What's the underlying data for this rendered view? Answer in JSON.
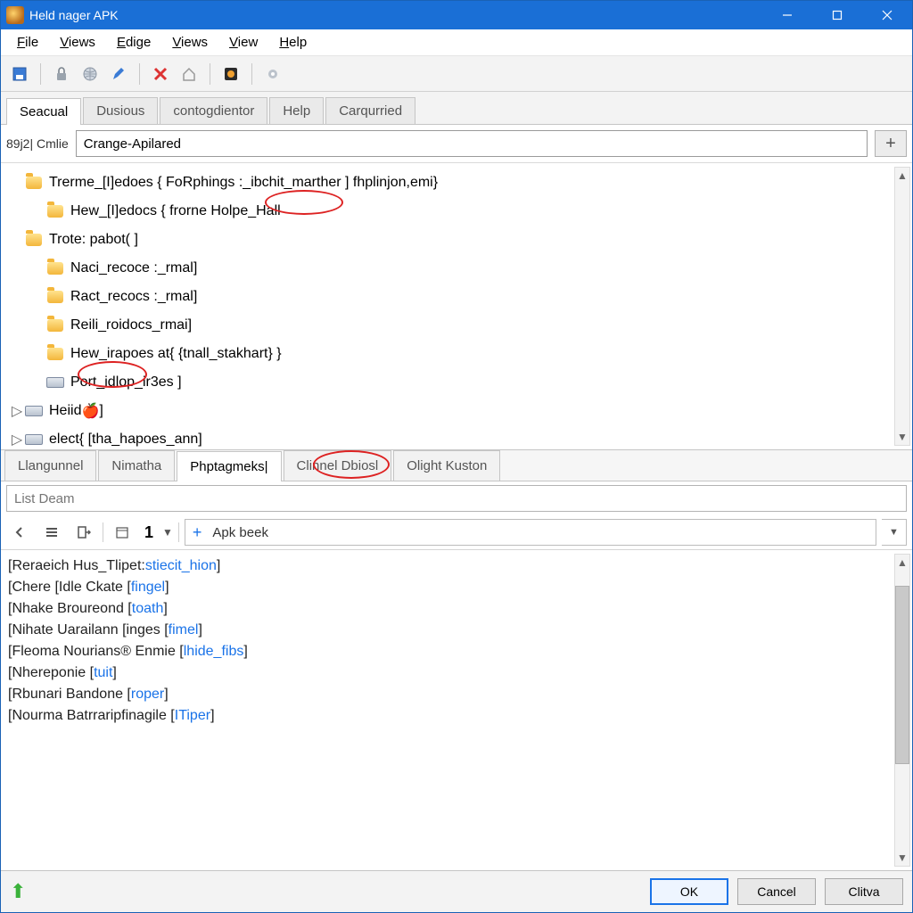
{
  "window": {
    "title": "Held nager  APK"
  },
  "menubar": [
    "File",
    "Views",
    "Edige",
    "Views",
    "View",
    "Help"
  ],
  "toolbar_icons": [
    "save-icon",
    "separator",
    "lock-icon",
    "globe-icon",
    "pencil-icon",
    "separator",
    "delete-icon",
    "home-icon",
    "separator",
    "bug-icon",
    "separator",
    "gear-icon"
  ],
  "top_tabs": [
    {
      "label": "Seacual",
      "active": true
    },
    {
      "label": "Dusious",
      "active": false
    },
    {
      "label": "contogdientor",
      "active": false
    },
    {
      "label": "Help",
      "active": false
    },
    {
      "label": "Carqurried",
      "active": false
    }
  ],
  "search": {
    "left_label": "89j2| Cmlie",
    "value": "Crange-Apilared"
  },
  "tree": [
    {
      "indent": 0,
      "icon": "folder",
      "text": "Trerme_[I]edoes { FoRphings :_ibchit_marther ] fhplinjon,emi}"
    },
    {
      "indent": 1,
      "icon": "folder",
      "text": "Hew_[I]edocs { frorne Holpe_Hall"
    },
    {
      "indent": 0,
      "icon": "folder",
      "text": "Trote: pabot( ]"
    },
    {
      "indent": 1,
      "icon": "folder",
      "text": "Naci_recoce :_rmal]"
    },
    {
      "indent": 1,
      "icon": "folder",
      "text": "Ract_recocs :_rmal]"
    },
    {
      "indent": 1,
      "icon": "folder",
      "text": "Reili_roidocs_rmai]"
    },
    {
      "indent": 1,
      "icon": "folder",
      "text": "Hew_irapoes at{ {tnall_stakhart} }"
    },
    {
      "indent": 1,
      "icon": "drive",
      "text": "Port_idlop_ir3es ]"
    },
    {
      "indent": 0,
      "icon": "drive",
      "caret": true,
      "extra": "apple",
      "text": "Heiid"
    },
    {
      "indent": 0,
      "icon": "drive",
      "caret": true,
      "text": "elect{ [tha_hapoes_ann]"
    }
  ],
  "mid_tabs": [
    {
      "label": "Llangunnel",
      "active": false
    },
    {
      "label": "Nimatha",
      "active": false
    },
    {
      "label": "Phptagmeks|",
      "active": true
    },
    {
      "label": "Clinnel Dbiosl",
      "active": false
    },
    {
      "label": "Olight Kuston",
      "active": false
    }
  ],
  "list_header_placeholder": "List Deam",
  "tool2": {
    "number": "1",
    "field": "Apk beek"
  },
  "list_lines": [
    {
      "pre": "[Reraeich Hus_Tlipet:",
      "val": "stiecit_hion",
      "post": "]"
    },
    {
      "pre": "[Chere [Idle Ckate [",
      "val": "fingel",
      "post": "]"
    },
    {
      "pre": "[Nhake Broureond [",
      "val": "toath",
      "post": "]"
    },
    {
      "pre": "[Nihate Uarailann [inges [",
      "val": "fimel",
      "post": "]"
    },
    {
      "pre": "[Fleoma Nourians® Enmie [",
      "val": "lhide_fibs",
      "post": "]"
    },
    {
      "pre": "[Nhereponie [",
      "val": "tuit",
      "post": "]"
    },
    {
      "pre": "[Rbunari Bandone [",
      "val": "roper",
      "post": "]"
    },
    {
      "pre": "[Nourma Batrraripfinagile [",
      "val": "ITiper",
      "post": "]"
    }
  ],
  "footer": {
    "ok": "OK",
    "cancel": "Cancel",
    "extra": "Clitva"
  }
}
